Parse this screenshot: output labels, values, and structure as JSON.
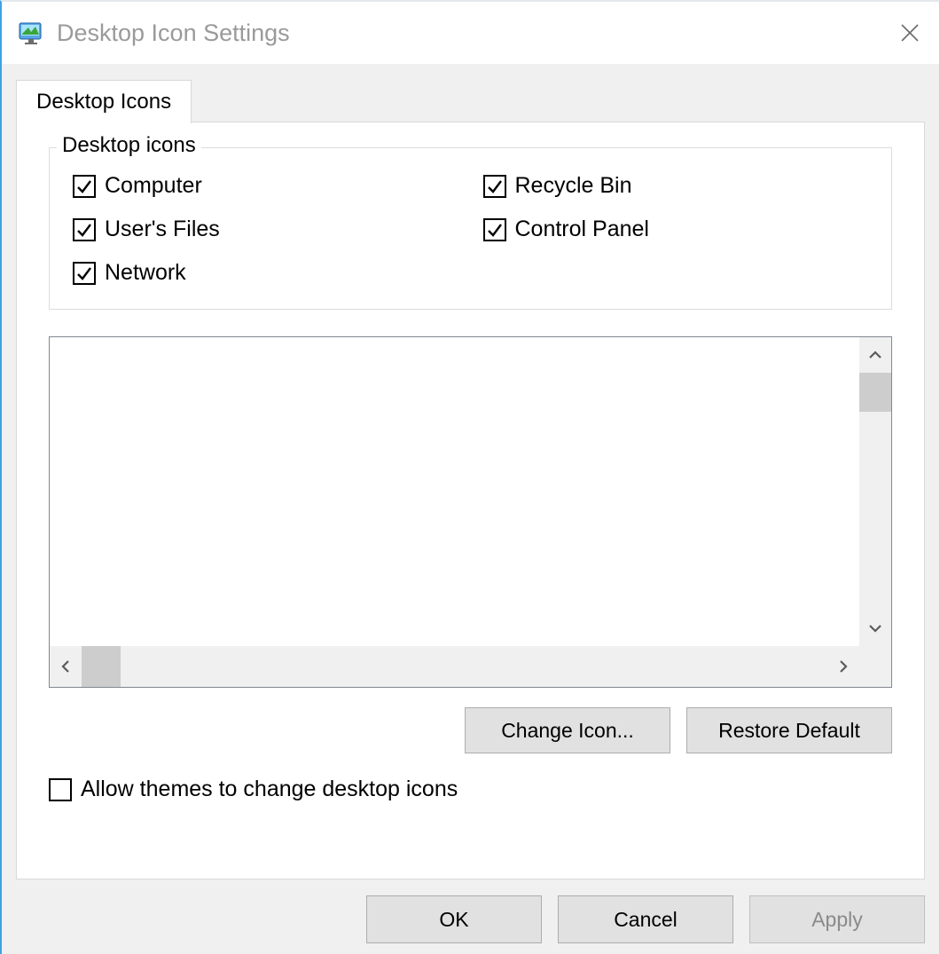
{
  "window": {
    "title": "Desktop Icon Settings",
    "tab_label": "Desktop Icons"
  },
  "fieldset": {
    "legend": "Desktop icons",
    "items": {
      "computer": {
        "label": "Computer",
        "checked": true
      },
      "users_files": {
        "label": "User's Files",
        "checked": true
      },
      "network": {
        "label": "Network",
        "checked": true
      },
      "recycle_bin": {
        "label": "Recycle Bin",
        "checked": true
      },
      "control_panel": {
        "label": "Control Panel",
        "checked": true
      }
    }
  },
  "buttons": {
    "change_icon": "Change Icon...",
    "restore_default": "Restore Default"
  },
  "allow_themes": {
    "label": "Allow themes to change desktop icons",
    "checked": false
  },
  "footer": {
    "ok": "OK",
    "cancel": "Cancel",
    "apply": "Apply",
    "apply_enabled": false
  }
}
